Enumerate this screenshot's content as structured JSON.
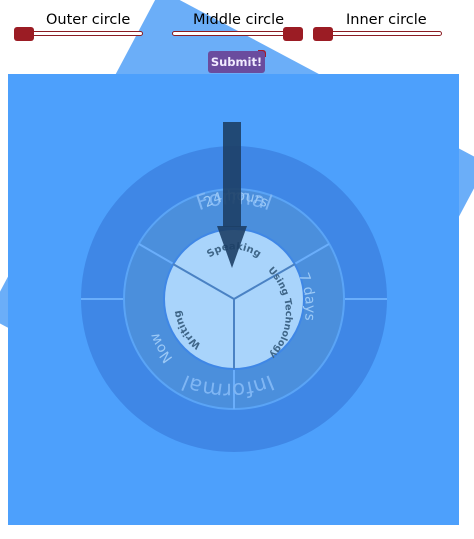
{
  "sliders": [
    {
      "label": "Outer circle",
      "value_fraction": 0.0
    },
    {
      "label": "Middle circle",
      "value_fraction": 1.0
    },
    {
      "label": "Inner circle",
      "value_fraction": 0.0
    }
  ],
  "submit_label": "Submit!",
  "wheel": {
    "outer": {
      "top": "Formal",
      "bottom": "Informal"
    },
    "middle": {
      "top": "24 hours",
      "right": "7 days",
      "left": "Now"
    },
    "inner": {
      "top": "Speaking",
      "right": "Using Technology",
      "left": "Writing"
    }
  },
  "colors": {
    "background_square": "#4da0fc",
    "outer_ring": "#3f87e6",
    "middle_ring": "#4b8fdc",
    "inner_disc": "#a9d4fb",
    "slider_thumb": "#9b1c24",
    "pointer": "#1d3f66"
  },
  "icons": {
    "pointer": "arrow-pointer-icon"
  }
}
